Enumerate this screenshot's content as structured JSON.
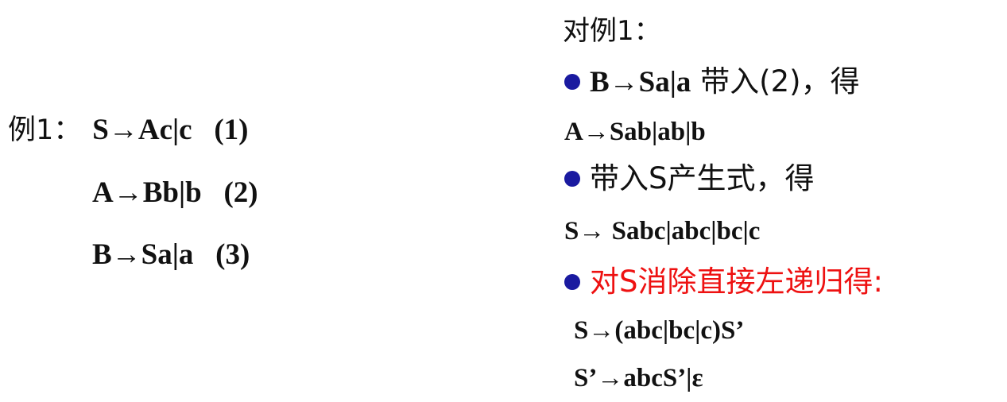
{
  "example": {
    "label": "例1：",
    "productions": [
      "S→Ac|c   (1)",
      "A→Bb|b   (2)",
      "B→Sa|a   (3)"
    ]
  },
  "counter": {
    "title": "对例1：",
    "steps": [
      {
        "bullet_formula": "B→Sa|a",
        "bullet_text": " 带入(2)，得",
        "result": "A→Sab|ab|b"
      },
      {
        "bullet_text": "带入S产生式，得",
        "result": "S→ Sabc|abc|bc|c"
      },
      {
        "bullet_text": "对S消除直接左递归得:",
        "results": [
          "S→(abc|bc|c)S’",
          "S’→abcS’|ε"
        ]
      }
    ]
  },
  "colors": {
    "bullet": "#1a1aa0",
    "highlight": "#ee1111",
    "text": "#111111"
  }
}
